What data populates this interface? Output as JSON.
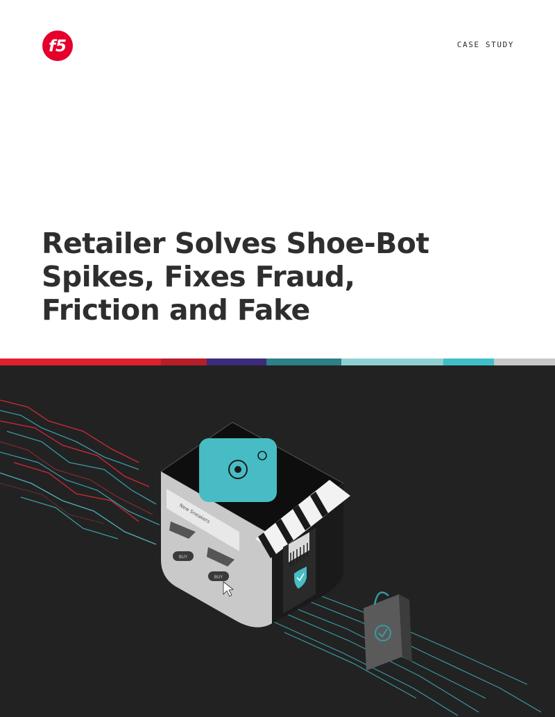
{
  "brand": {
    "logo_text": "f5",
    "logo_color": "#e4002b"
  },
  "header": {
    "doc_type": "CASE STUDY"
  },
  "title": {
    "lines": [
      "Retailer Solves Shoe-Bot",
      "Spikes, Fixes Fraud,",
      "Friction and Fake"
    ]
  },
  "color_band": [
    "#e21f2f",
    "#b81d2a",
    "#3b2b7a",
    "#2f7f86",
    "#8fd1d2",
    "#3fbfc7",
    "#c8c8c8"
  ],
  "illustration": {
    "background": "#222222",
    "store_window_text": "New Sneakers",
    "button_labels": [
      "BUY",
      "BUY"
    ],
    "icons": [
      "store-icon",
      "network-gear-icon",
      "lightbulb-icon",
      "sneaker-icon",
      "barcode-icon",
      "shield-check-icon",
      "shopping-bag-icon",
      "cursor-icon"
    ]
  }
}
